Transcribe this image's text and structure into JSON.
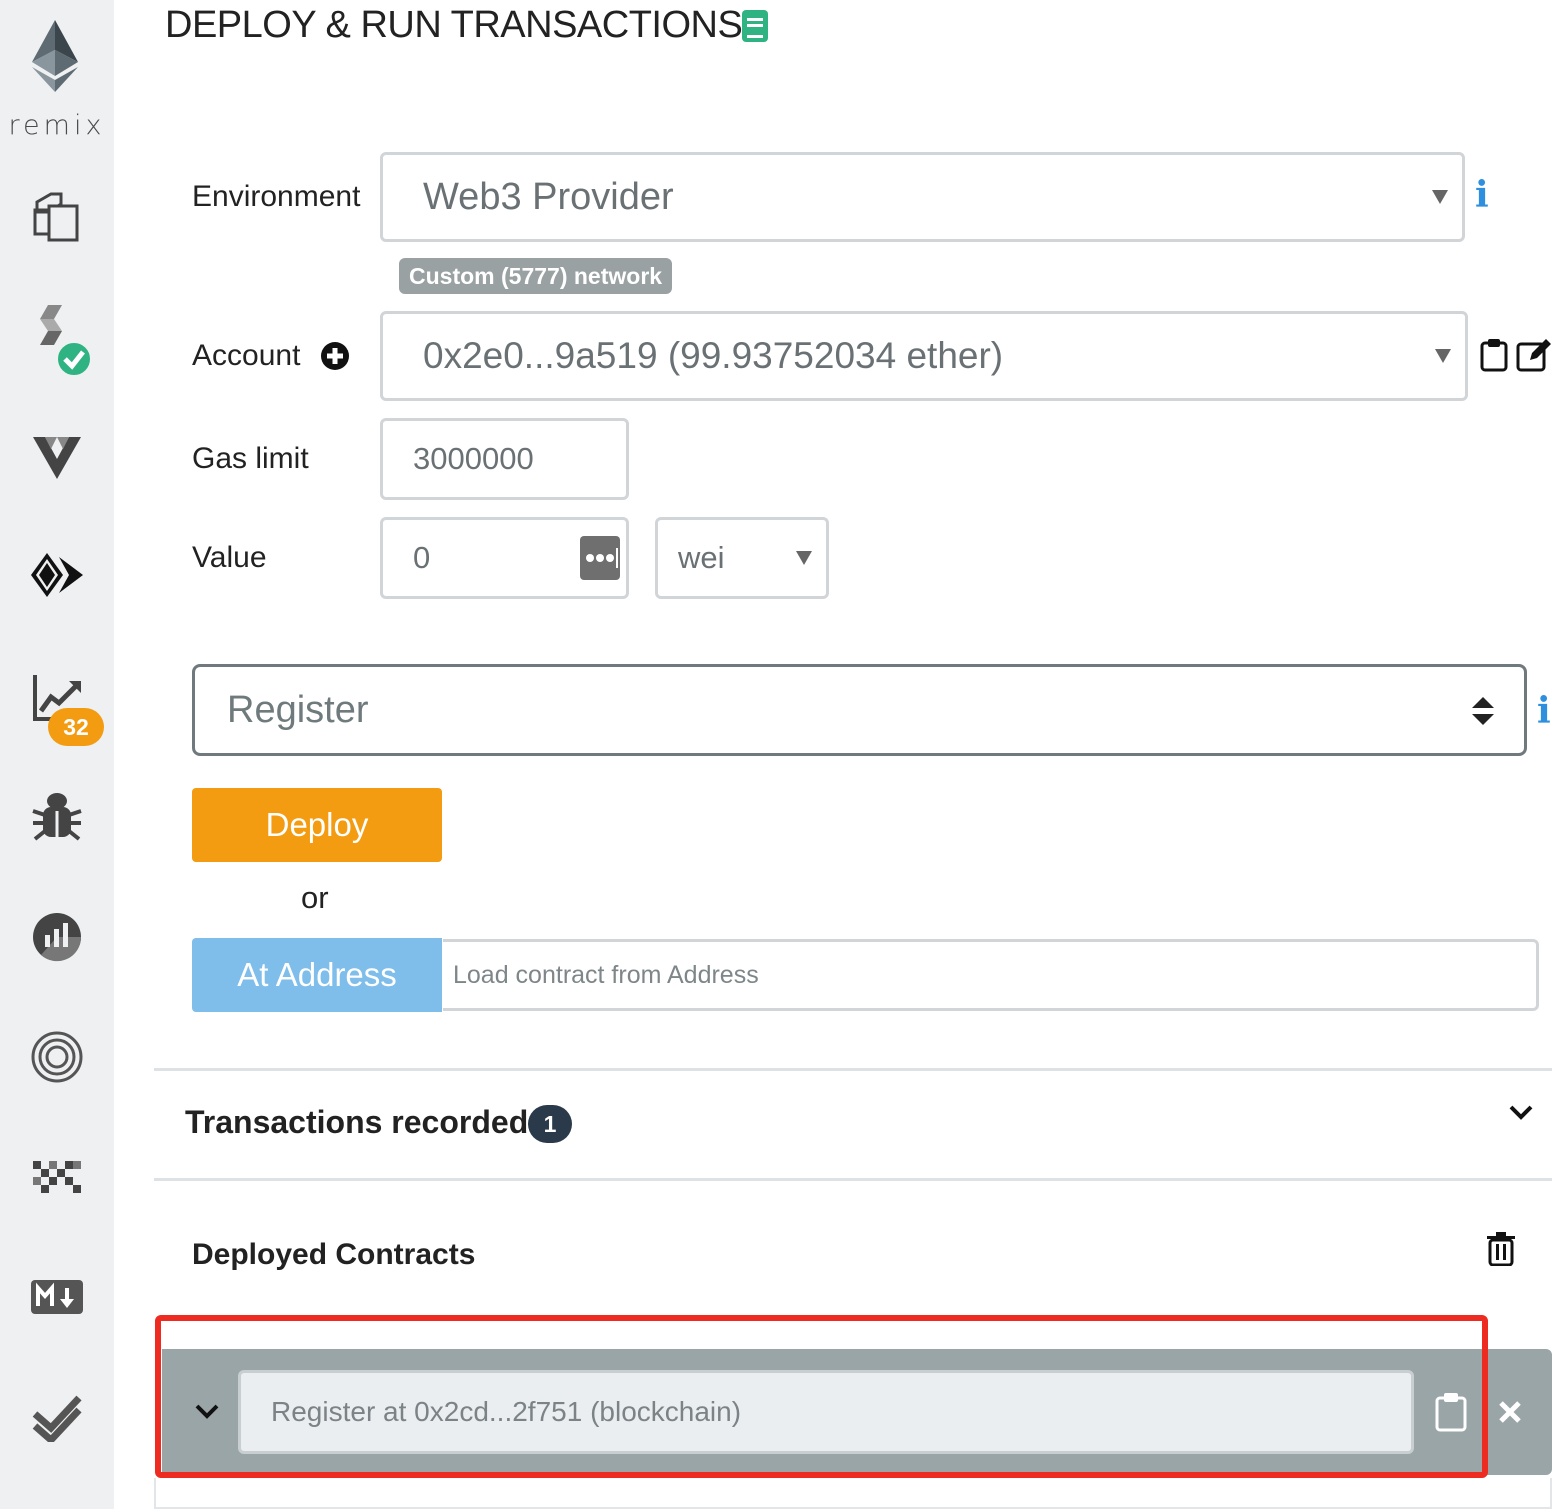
{
  "sidebar": {
    "logo_text": "remix",
    "items": [
      {
        "name": "file-explorer",
        "icon": "files-icon"
      },
      {
        "name": "solidity-compiler",
        "icon": "solidity-icon"
      },
      {
        "name": "vyper",
        "icon": "vyper-icon"
      },
      {
        "name": "deploy-run",
        "icon": "deploy-icon"
      },
      {
        "name": "analysis",
        "icon": "chart-icon",
        "badge": "32"
      },
      {
        "name": "debugger",
        "icon": "bug-icon"
      },
      {
        "name": "gas-profiler",
        "icon": "pie-chart-icon"
      },
      {
        "name": "plugin",
        "icon": "rings-icon"
      },
      {
        "name": "pixel-plugin",
        "icon": "pixel-icon"
      },
      {
        "name": "markdown",
        "icon": "markdown-icon"
      },
      {
        "name": "tests",
        "icon": "double-check-icon"
      }
    ]
  },
  "header": {
    "title": "DEPLOY & RUN TRANSACTIONS"
  },
  "form": {
    "environment_label": "Environment",
    "environment_value": "Web3 Provider",
    "network_badge": "Custom (5777) network",
    "account_label": "Account",
    "account_value": "0x2e0...9a519 (99.93752034 ether)",
    "gas_label": "Gas limit",
    "gas_value": "3000000",
    "value_label": "Value",
    "value_amount": "0",
    "value_unit": "wei"
  },
  "contract": {
    "selected": "Register",
    "deploy_label": "Deploy",
    "or_label": "or",
    "at_address_label": "At Address",
    "at_address_placeholder": "Load contract from Address"
  },
  "transactions": {
    "label": "Transactions recorded:",
    "count": "1"
  },
  "deployed": {
    "label": "Deployed Contracts",
    "instance_label": "Register at 0x2cd...2f751 (blockchain)"
  },
  "colors": {
    "accent_orange": "#f39c12",
    "at_address_blue": "#7fbdeb",
    "info_blue": "#2d8fdd",
    "highlight_red": "#ee2b20",
    "sidebar_bg": "#eef0f2"
  }
}
